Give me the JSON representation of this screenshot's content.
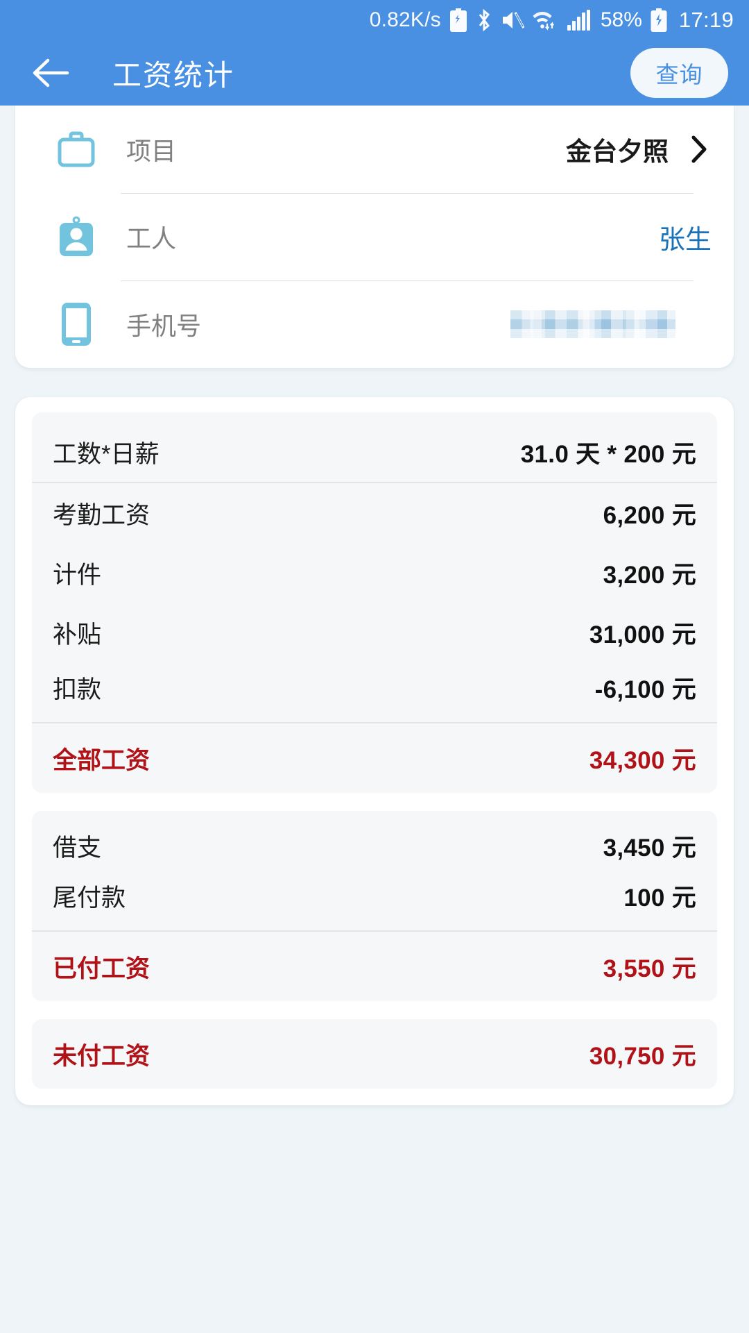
{
  "statusbar": {
    "network_speed": "0.82K/s",
    "battery_percent": "58%",
    "time": "17:19",
    "icons": [
      "battery-saver-icon",
      "bluetooth-icon",
      "mute-icon",
      "wifi-icon",
      "signal-icon",
      "battery-charging-icon"
    ]
  },
  "appbar": {
    "back_label": "back-arrow-icon",
    "title": "工资统计",
    "query_label": "查询"
  },
  "info": {
    "rows": [
      {
        "icon": "briefcase-icon",
        "label": "项目",
        "value": "金台夕照",
        "type": "chevron"
      },
      {
        "icon": "id-badge-icon",
        "label": "工人",
        "value": "张生",
        "type": "link"
      },
      {
        "icon": "phone-icon",
        "label": "手机号",
        "value": "",
        "type": "mosaic"
      }
    ]
  },
  "salary": {
    "block1": {
      "header": {
        "label": "工数*日薪",
        "value": "31.0 天 * 200 元"
      },
      "rows": [
        {
          "label": "考勤工资",
          "value": "6,200 元"
        },
        {
          "label": "计件",
          "value": "3,200 元"
        },
        {
          "label": "补贴",
          "value": "31,000 元"
        },
        {
          "label": "扣款",
          "value": "-6,100 元"
        }
      ],
      "total": {
        "label": "全部工资",
        "value": "34,300 元"
      }
    },
    "block2": {
      "rows": [
        {
          "label": "借支",
          "value": "3,450 元"
        },
        {
          "label": "尾付款",
          "value": "100 元"
        }
      ],
      "total": {
        "label": "已付工资",
        "value": "3,550 元"
      }
    },
    "block3": {
      "total": {
        "label": "未付工资",
        "value": "30,750 元"
      }
    }
  },
  "colors": {
    "primary": "#4a90e2",
    "accent_red": "#b01218",
    "link_blue": "#1a72b8",
    "icon_blue": "#72c4de",
    "page_bg": "#eef4f7"
  }
}
